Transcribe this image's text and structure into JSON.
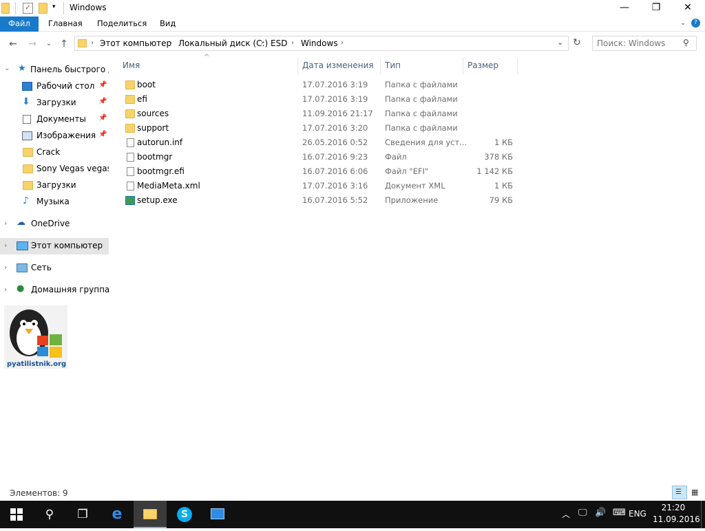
{
  "window": {
    "title": "Windows"
  },
  "ribbon": {
    "tabs": [
      "Файл",
      "Главная",
      "Поделиться",
      "Вид"
    ]
  },
  "address": {
    "path": [
      "Этот компьютер",
      "Локальный диск (C:)",
      "ESD",
      "Windows"
    ],
    "search_placeholder": "Поиск: Windows"
  },
  "nav": {
    "quick_access": "Панель быстрого до",
    "items": [
      {
        "label": "Рабочий стол",
        "icon": "desktop-icon",
        "pinned": true
      },
      {
        "label": "Загрузки",
        "icon": "download-icon",
        "pinned": true
      },
      {
        "label": "Документы",
        "icon": "documents-icon",
        "pinned": true
      },
      {
        "label": "Изображения",
        "icon": "pictures-icon",
        "pinned": true
      },
      {
        "label": "Crack",
        "icon": "folder-icon",
        "pinned": false
      },
      {
        "label": "Sony Vegas vegaspr",
        "icon": "folder-icon",
        "pinned": false
      },
      {
        "label": "Загрузки",
        "icon": "folder-icon",
        "pinned": false
      },
      {
        "label": "Музыка",
        "icon": "music-icon",
        "pinned": false
      }
    ],
    "onedrive": "OneDrive",
    "this_pc": "Этот компьютер",
    "network": "Сеть",
    "homegroup": "Домашняя группа",
    "watermark_text": "pyatilistnik.org"
  },
  "columns": {
    "name": "Имя",
    "date": "Дата изменения",
    "type": "Тип",
    "size": "Размер"
  },
  "files": [
    {
      "name": "boot",
      "date": "17.07.2016 3:19",
      "type": "Папка с файлами",
      "size": "",
      "icon": "folder-icon"
    },
    {
      "name": "efi",
      "date": "17.07.2016 3:19",
      "type": "Папка с файлами",
      "size": "",
      "icon": "folder-icon"
    },
    {
      "name": "sources",
      "date": "11.09.2016 21:17",
      "type": "Папка с файлами",
      "size": "",
      "icon": "folder-icon"
    },
    {
      "name": "support",
      "date": "17.07.2016 3:20",
      "type": "Папка с файлами",
      "size": "",
      "icon": "folder-icon"
    },
    {
      "name": "autorun.inf",
      "date": "26.05.2016 0:52",
      "type": "Сведения для уст...",
      "size": "1 КБ",
      "icon": "settings-file-icon"
    },
    {
      "name": "bootmgr",
      "date": "16.07.2016 9:23",
      "type": "Файл",
      "size": "378 КБ",
      "icon": "file-icon"
    },
    {
      "name": "bootmgr.efi",
      "date": "16.07.2016 6:06",
      "type": "Файл \"EFI\"",
      "size": "1 142 КБ",
      "icon": "file-icon"
    },
    {
      "name": "MediaMeta.xml",
      "date": "17.07.2016 3:16",
      "type": "Документ XML",
      "size": "1 КБ",
      "icon": "xml-file-icon"
    },
    {
      "name": "setup.exe",
      "date": "16.07.2016 5:52",
      "type": "Приложение",
      "size": "79 КБ",
      "icon": "setup-exe-icon"
    }
  ],
  "status": {
    "items_count": "Элементов: 9"
  },
  "taskbar": {
    "language": "ENG",
    "time": "21:20",
    "date": "11.09.2016"
  },
  "colors": {
    "accent": "#1979ca",
    "folder": "#f8d36b",
    "taskbar": "#101010"
  }
}
